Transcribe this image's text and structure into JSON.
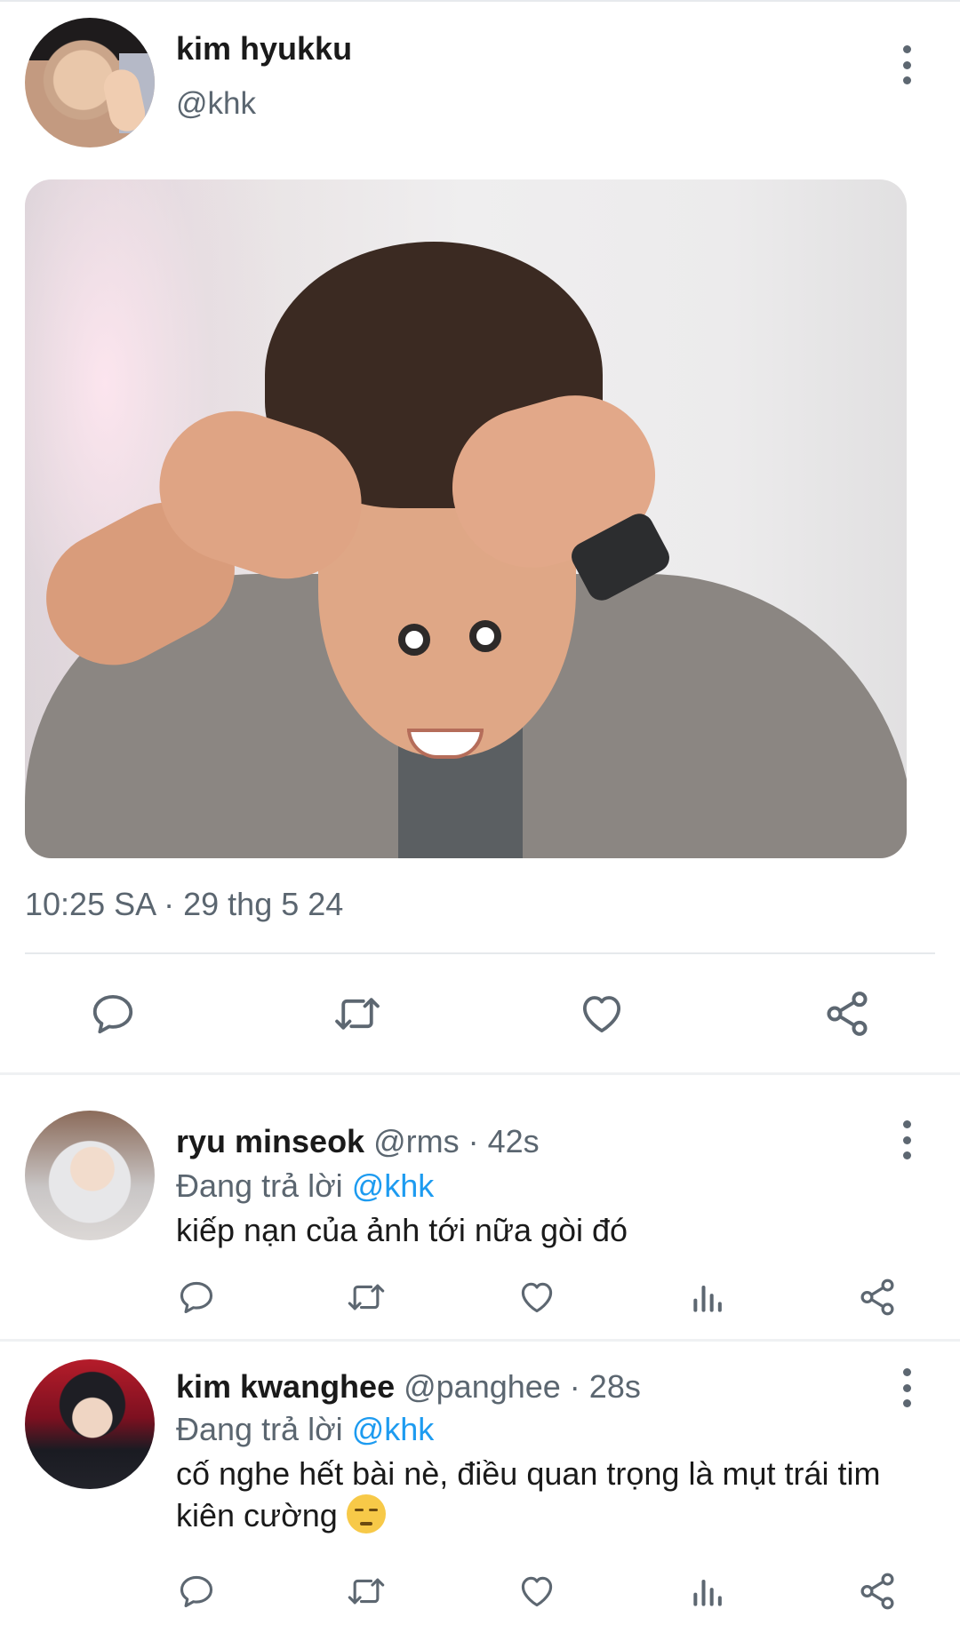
{
  "main_tweet": {
    "display_name": "kim hyukku",
    "handle": "@khk",
    "timestamp": "10:25 SA · 29 thg 5 24",
    "actions": [
      "reply-icon",
      "retweet-icon",
      "like-icon",
      "share-icon"
    ]
  },
  "replies": [
    {
      "display_name": "ryu minseok",
      "meta": "@rms · 42s",
      "reply_prefix": "Đang trả lời",
      "reply_mention": "@khk",
      "text": "kiếp nạn của ảnh tới nữa gòi đó"
    },
    {
      "display_name": "kim kwanghee",
      "meta": "@panghee · 28s",
      "reply_prefix": "Đang trả lời",
      "reply_mention": "@khk",
      "text": "cố nghe hết bài nè, điều quan trọng là mụt trái tim kiên cường",
      "emoji": "😔"
    }
  ],
  "colors": {
    "accent_link": "#1d9bf0",
    "secondary_text": "#5b6670",
    "icon": "#5d6771"
  }
}
